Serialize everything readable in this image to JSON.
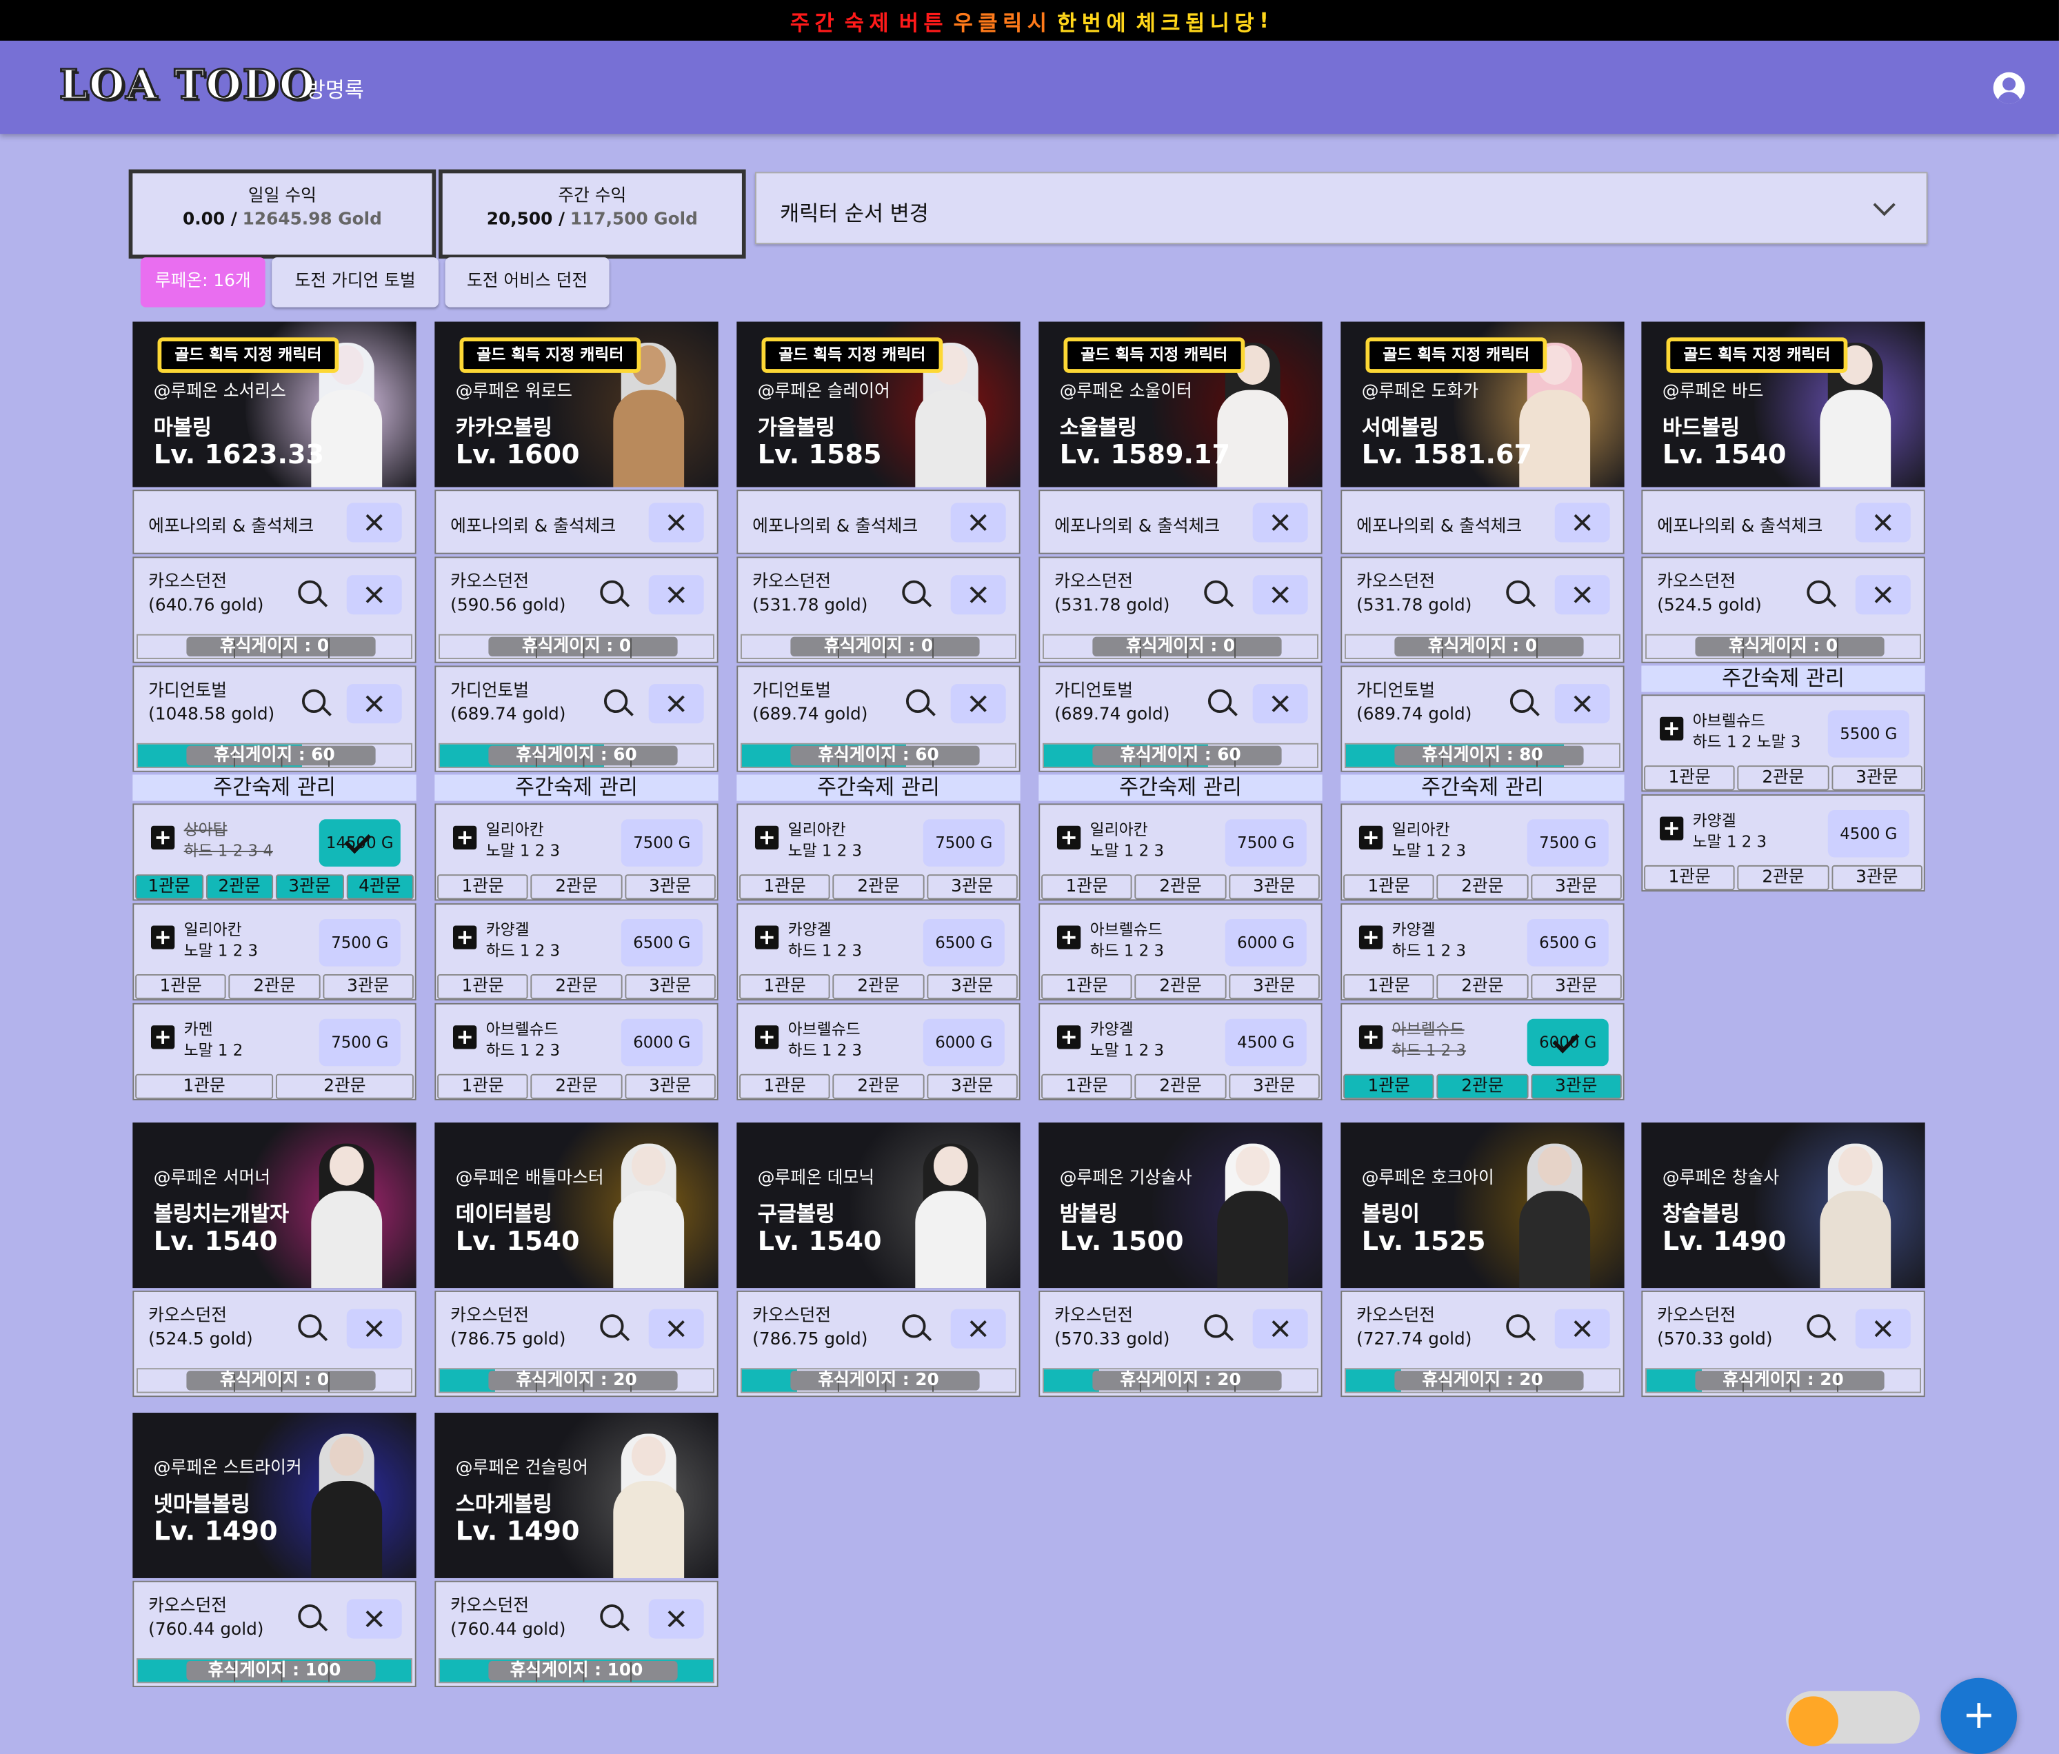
{
  "banner": {
    "text": "주 간   숙 제   버 튼   우 클 릭 시   한 번 에   체 크 됩 니 당 !",
    "colors": [
      "#ff1a1a",
      "#ff7a1a",
      "#ffd61a"
    ]
  },
  "header": {
    "logo": "LOA TODO",
    "nav_guestbook": "방명록",
    "account_icon": "account-circle-icon"
  },
  "earnings": {
    "daily": {
      "title": "일일 수익",
      "current": "0.00 /",
      "total": "12645.98 Gold"
    },
    "weekly": {
      "title": "주간 수익",
      "current": "20,500 /",
      "total": "117,500 Gold"
    }
  },
  "order_select": {
    "label": "캐릭터 순서 변경"
  },
  "chips": {
    "server": "루페온: 16개",
    "guardian": "도전 가디언 토벌",
    "abyss": "도전 어비스 던전"
  },
  "labels": {
    "epona": "에포나의뢰 & 출석체크",
    "chaos": "카오스던전",
    "guardian": "가디언토벌",
    "weekly": "주간숙제 관리",
    "gold_tag": "골드 획득 지정 캐릭터",
    "rest_prefix": "휴식게이지 : "
  },
  "characters": [
    {
      "class": "@루페온 소서리스",
      "name": "마볼링",
      "level": "Lv. 1623.33",
      "gold_tag": true,
      "theme": "sorc",
      "chaos": "(640.76 gold)",
      "chaos_rest": 0,
      "guardian": "(1048.58 gold)",
      "guardian_rest": 60,
      "raids": [
        {
          "name": "상아탑",
          "diff": "하드 1 2 3 4",
          "gold": "14500 G",
          "done": true,
          "gates": [
            "1관문",
            "2관문",
            "3관문",
            "4관문"
          ],
          "cleared": 4
        },
        {
          "name": "일리아칸",
          "diff": "노말 1 2 3",
          "gold": "7500 G",
          "done": false,
          "gates": [
            "1관문",
            "2관문",
            "3관문"
          ],
          "cleared": 0
        },
        {
          "name": "카멘",
          "diff": "노말 1 2",
          "gold": "7500 G",
          "done": false,
          "gates": [
            "1관문",
            "2관문"
          ],
          "cleared": 0
        }
      ]
    },
    {
      "class": "@루페온 워로드",
      "name": "카카오볼링",
      "level": "Lv. 1600",
      "gold_tag": true,
      "theme": "warlord",
      "chaos": "(590.56 gold)",
      "chaos_rest": 0,
      "guardian": "(689.74 gold)",
      "guardian_rest": 60,
      "raids": [
        {
          "name": "일리아칸",
          "diff": "노말 1 2 3",
          "gold": "7500 G",
          "done": false,
          "gates": [
            "1관문",
            "2관문",
            "3관문"
          ],
          "cleared": 0
        },
        {
          "name": "카양겔",
          "diff": "하드 1 2 3",
          "gold": "6500 G",
          "done": false,
          "gates": [
            "1관문",
            "2관문",
            "3관문"
          ],
          "cleared": 0
        },
        {
          "name": "아브렐슈드",
          "diff": "하드 1 2 3",
          "gold": "6000 G",
          "done": false,
          "gates": [
            "1관문",
            "2관문",
            "3관문"
          ],
          "cleared": 0
        }
      ]
    },
    {
      "class": "@루페온 슬레이어",
      "name": "가을볼링",
      "level": "Lv. 1585",
      "gold_tag": true,
      "theme": "slayer",
      "chaos": "(531.78 gold)",
      "chaos_rest": 0,
      "guardian": "(689.74 gold)",
      "guardian_rest": 60,
      "raids": [
        {
          "name": "일리아칸",
          "diff": "노말 1 2 3",
          "gold": "7500 G",
          "done": false,
          "gates": [
            "1관문",
            "2관문",
            "3관문"
          ],
          "cleared": 0
        },
        {
          "name": "카양겔",
          "diff": "하드 1 2 3",
          "gold": "6500 G",
          "done": false,
          "gates": [
            "1관문",
            "2관문",
            "3관문"
          ],
          "cleared": 0
        },
        {
          "name": "아브렐슈드",
          "diff": "하드 1 2 3",
          "gold": "6000 G",
          "done": false,
          "gates": [
            "1관문",
            "2관문",
            "3관문"
          ],
          "cleared": 0
        }
      ]
    },
    {
      "class": "@루페온 소울이터",
      "name": "소울볼링",
      "level": "Lv. 1589.17",
      "gold_tag": true,
      "theme": "soul",
      "chaos": "(531.78 gold)",
      "chaos_rest": 0,
      "guardian": "(689.74 gold)",
      "guardian_rest": 60,
      "raids": [
        {
          "name": "일리아칸",
          "diff": "노말 1 2 3",
          "gold": "7500 G",
          "done": false,
          "gates": [
            "1관문",
            "2관문",
            "3관문"
          ],
          "cleared": 0
        },
        {
          "name": "아브렐슈드",
          "diff": "하드 1 2 3",
          "gold": "6000 G",
          "done": false,
          "gates": [
            "1관문",
            "2관문",
            "3관문"
          ],
          "cleared": 0
        },
        {
          "name": "카양겔",
          "diff": "노말 1 2 3",
          "gold": "4500 G",
          "done": false,
          "gates": [
            "1관문",
            "2관문",
            "3관문"
          ],
          "cleared": 0
        }
      ]
    },
    {
      "class": "@루페온 도화가",
      "name": "서예볼링",
      "level": "Lv. 1581.67",
      "gold_tag": true,
      "theme": "artist",
      "chaos": "(531.78 gold)",
      "chaos_rest": 0,
      "guardian": "(689.74 gold)",
      "guardian_rest": 80,
      "raids": [
        {
          "name": "일리아칸",
          "diff": "노말 1 2 3",
          "gold": "7500 G",
          "done": false,
          "gates": [
            "1관문",
            "2관문",
            "3관문"
          ],
          "cleared": 0
        },
        {
          "name": "카양겔",
          "diff": "하드 1 2 3",
          "gold": "6500 G",
          "done": false,
          "gates": [
            "1관문",
            "2관문",
            "3관문"
          ],
          "cleared": 0
        },
        {
          "name": "아브렐슈드",
          "diff": "하드 1 2 3",
          "gold": "6000 G",
          "done": true,
          "gates": [
            "1관문",
            "2관문",
            "3관문"
          ],
          "cleared": 3
        }
      ]
    },
    {
      "class": "@루페온 바드",
      "name": "바드볼링",
      "level": "Lv. 1540",
      "gold_tag": true,
      "theme": "bard",
      "chaos": "(524.5 gold)",
      "chaos_rest": 0,
      "guardian": null,
      "raids": [
        {
          "name": "아브렐슈드",
          "diff": "하드 1 2 노말 3",
          "gold": "5500 G",
          "done": false,
          "gates": [
            "1관문",
            "2관문",
            "3관문"
          ],
          "cleared": 0
        },
        {
          "name": "카양겔",
          "diff": "노말 1 2 3",
          "gold": "4500 G",
          "done": false,
          "gates": [
            "1관문",
            "2관문",
            "3관문"
          ],
          "cleared": 0
        }
      ]
    },
    {
      "class": "@루페온 서머너",
      "name": "볼링치는개발자",
      "level": "Lv. 1540",
      "gold_tag": false,
      "theme": "summoner",
      "chaos": "(524.5 gold)",
      "chaos_rest": 0
    },
    {
      "class": "@루페온 배틀마스터",
      "name": "데이터볼링",
      "level": "Lv. 1540",
      "gold_tag": false,
      "theme": "bm",
      "chaos": "(786.75 gold)",
      "chaos_rest": 20
    },
    {
      "class": "@루페온 데모닉",
      "name": "구글볼링",
      "level": "Lv. 1540",
      "gold_tag": false,
      "theme": "demonic",
      "chaos": "(786.75 gold)",
      "chaos_rest": 20
    },
    {
      "class": "@루페온 기상술사",
      "name": "밤볼링",
      "level": "Lv. 1500",
      "gold_tag": false,
      "theme": "aero",
      "chaos": "(570.33 gold)",
      "chaos_rest": 20
    },
    {
      "class": "@루페온 호크아이",
      "name": "볼링이",
      "level": "Lv. 1525",
      "gold_tag": false,
      "theme": "hawk",
      "chaos": "(727.74 gold)",
      "chaos_rest": 20
    },
    {
      "class": "@루페온 창술사",
      "name": "창술볼링",
      "level": "Lv. 1490",
      "gold_tag": false,
      "theme": "lance",
      "chaos": "(570.33 gold)",
      "chaos_rest": 20
    },
    {
      "class": "@루페온 스트라이커",
      "name": "넷마블볼링",
      "level": "Lv. 1490",
      "gold_tag": false,
      "theme": "striker",
      "chaos": "(760.44 gold)",
      "chaos_rest": 100
    },
    {
      "class": "@루페온 건슬링어",
      "name": "스마게볼링",
      "level": "Lv. 1490",
      "gold_tag": false,
      "theme": "gs",
      "chaos": "(760.44 gold)",
      "chaos_rest": 100
    }
  ],
  "fab": {
    "label": "+"
  },
  "colors": {
    "accent": "#7770d5",
    "teal": "#12b8b8",
    "bg": "#b3b3ec",
    "card": "#dcdcf7",
    "chip_pink": "#e96ef0"
  }
}
